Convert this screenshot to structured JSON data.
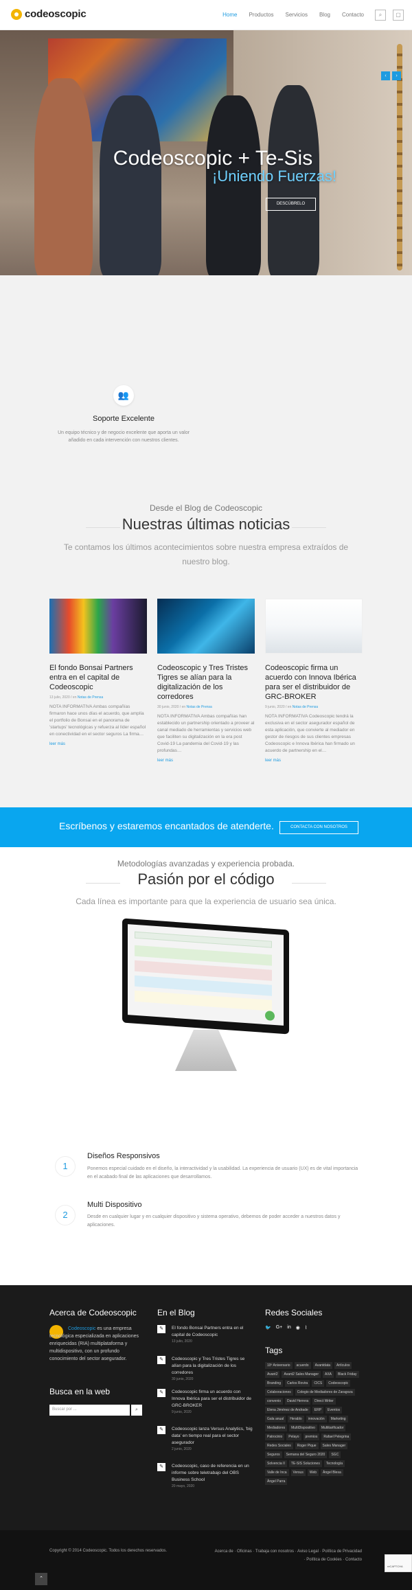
{
  "header": {
    "logo": "codeoscopic",
    "nav": [
      "Home",
      "Productos",
      "Servicios",
      "Blog",
      "Contacto"
    ]
  },
  "hero": {
    "title": "Codeoscopic + Te-Sis",
    "subtitle": "¡Uniendo Fuerzas!",
    "button": "DESCÚBRELO"
  },
  "support": {
    "title": "Soporte Excelente",
    "text": "Un equipo técnico y de negocio excelente que aporta un valor añadido en cada intervención con nuestros clientes."
  },
  "blog": {
    "kicker": "Desde el Blog de Codeoscopic",
    "title": "Nuestras últimas noticias",
    "subtitle": "Te contamos los últimos acontecimientos sobre nuestra empresa extraídos de nuestro blog.",
    "posts": [
      {
        "title": "El fondo Bonsai Partners entra en el capital de Codeoscopic",
        "date": "13 julio, 2020",
        "category": "Notas de Prensa",
        "excerpt": "NOTA INFORMATIVA Ambas compañías firmaron hace unos días el acuerdo, que amplía el portfolio de Bonsai en el panorama de 'startups' tecnológicas y refuerza al líder español en conectividad en el sector seguros La firma…",
        "more": "leer más"
      },
      {
        "title": "Codeoscopic y Tres Tristes Tigres se alían para la digitalización de los corredores",
        "date": "30 junio, 2020",
        "category": "Notas de Prensa",
        "excerpt": "NOTA INFORMATIVA Ambas compañías han establecido un partnership orientado a proveer al canal mediado de herramientas y servicios web que faciliten su digitalización en la era post Covid-19 La pandemia del Covid-19 y las profundas…",
        "more": "leer más"
      },
      {
        "title": "Codeoscopic firma un acuerdo con Innova Ibérica para ser el distribuidor de GRC-BROKER",
        "date": "9 junio, 2020",
        "category": "Notas de Prensa",
        "excerpt": "NOTA INFORMATIVA Codeoscopic tendrá la exclusiva en el sector asegurador español de esta aplicación, que convierte al mediador en gestor de riesgos de sus clientes empresas Codeoscopic e Innova Ibérica han firmado un acuerdo de partnership en el…",
        "more": "leer más"
      }
    ]
  },
  "cta": {
    "text": "Escríbenos y estaremos encantados de atenderte.",
    "button": "CONTACTA CON NOSOTROS"
  },
  "passion": {
    "kicker": "Metodologías avanzadas y experiencia probada.",
    "title": "Pasión por el código",
    "subtitle": "Cada línea es importante para que la experiencia de usuario sea única.",
    "features": [
      {
        "num": "1",
        "title": "Diseños Responsivos",
        "text": "Ponemos especial cuidado en el diseño, la interactividad y la usabilidad. La experiencia de usuario (UX) es de vital importancia en el acabado final de las aplicaciones que desarrollamos."
      },
      {
        "num": "2",
        "title": "Multi Dispositivo",
        "text": "Desde en cualquier lugar y en cualquier dispositivo y sistema operativo, debemos de poder acceder a nuestros datos y aplicaciones."
      }
    ]
  },
  "footer": {
    "about_title": "Acerca de Codeoscopic",
    "about_link": "Codeoscopic",
    "about_text": " es una empresa tecnológica especializada en aplicaciones enriquecidas (RIA) multiplataforma y multidispositivo, con un profundo conocimiento del sector asegurador.",
    "search_title": "Busca en la web",
    "search_placeholder": "Buscar por ...",
    "blog_title": "En el Blog",
    "blog_posts": [
      {
        "title": "El fondo Bonsai Partners entra en el capital de Codeoscopic",
        "date": "13 julio, 2020"
      },
      {
        "title": "Codeoscopic y Tres Tristes Tigres se alían para la digitalización de los corredores",
        "date": "30 junio, 2020"
      },
      {
        "title": "Codeoscopic firma un acuerdo con Innova Ibérica para ser el distribuidor de GRC-BROKER",
        "date": "9 junio, 2020"
      },
      {
        "title": "Codeoscopic lanza Versus Analytics, 'big data' en tiempo real para el sector asegurador",
        "date": "2 junio, 2020"
      },
      {
        "title": "Codeoscopic, caso de referencia en un informe sobre teletrabajo del OBS Business School",
        "date": "20 mayo, 2020"
      }
    ],
    "social_title": "Redes Sociales",
    "tags_title": "Tags",
    "tags": [
      "10º Aniversario",
      "acuerdo",
      "Avantdata",
      "Artículos",
      "Avant2",
      "Avant2 Sales Manager",
      "AXA",
      "Black Friday",
      "Branding",
      "Carlos Rovira",
      "CICS",
      "Codeoscopic",
      "Colaboraciones",
      "Colegio de Mediadores de Zaragoza",
      "convenio",
      "David Herrera",
      "Direct Writer",
      "Elena Jiménez de Andrade",
      "ERP",
      "Eventos",
      "Gala anual",
      "Herablo",
      "innovación",
      "Marketing",
      "Mediadores",
      "MultiDispositivo",
      "Multitarificador",
      "Patrocinio",
      "Pelayo",
      "premios",
      "Rafael Pelegrina",
      "Redes Sociales",
      "Roger Pique",
      "Sales Manager",
      "Seguros",
      "Semana del Seguro 2020",
      "SGC",
      "Solvencia II",
      "TE-SIS Soluciones",
      "Tecnología",
      "Valle de Inca",
      "Versus",
      "Web",
      "Ángel Blesa",
      "Ángel Parra"
    ],
    "copyright": "Copyright © 2014 Codeoscopic. Todos los derechos reservados.",
    "bottom_links": "Acerca de · Oficinas · Trabaja con nosotros · Aviso Legal · Política de Privacidad · Política de Cookies · Contacto"
  },
  "colors": {
    "accent": "#1e9be0",
    "cta": "#09a6ef",
    "footer": "#1b1b1b"
  }
}
